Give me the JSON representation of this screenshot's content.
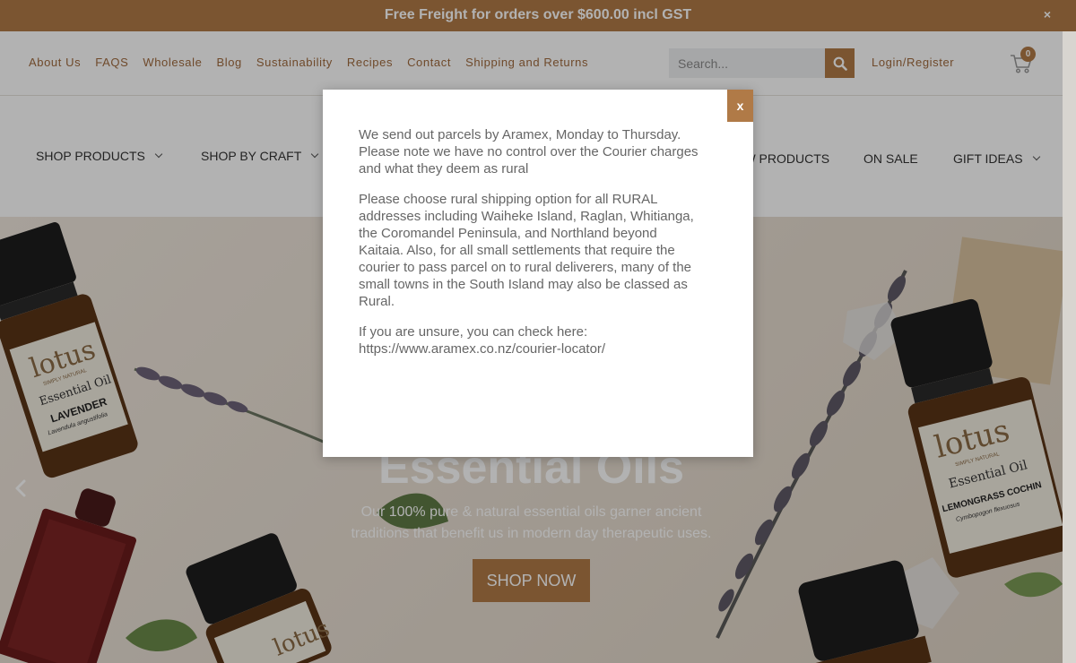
{
  "announcement": {
    "text": "Free Freight for orders over $600.00 incl GST",
    "close_label": "×"
  },
  "utility_nav": [
    "About Us",
    "FAQS",
    "Wholesale",
    "Blog",
    "Sustainability",
    "Recipes",
    "Contact",
    "Shipping and Returns"
  ],
  "search": {
    "placeholder": "Search...",
    "icon": "search-icon"
  },
  "account": {
    "label": "Login/Register"
  },
  "cart": {
    "count": "0",
    "icon": "cart-icon"
  },
  "main_nav": {
    "shop_products": "SHOP PRODUCTS",
    "shop_by_craft": "SHOP BY CRAFT",
    "new_products": "NEW PRODUCTS",
    "on_sale": "ON SALE",
    "gift_ideas": "GIFT IDEAS"
  },
  "hero": {
    "title": "Essential Oils",
    "subtitle_line1": "Our 100% pure & natural essential oils garner ancient",
    "subtitle_line2": "traditions that benefit us in modern day therapeutic uses.",
    "cta": "SHOP NOW"
  },
  "modal": {
    "close_label": "x",
    "p1_l1": "We send out parcels by Aramex, Monday to Thursday.",
    "p1_l2": "Please note we have no control over the Courier charges",
    "p1_l3": "and what they deem as rural",
    "p2_l1": "Please choose rural shipping option for all RURAL",
    "p2_l2": "addresses including Waiheke Island, Raglan, Whitianga,",
    "p2_l3": "the Coromandel Peninsula, and Northland beyond",
    "p2_l4": "Kaitaia.  Also, for all small settlements that require the",
    "p2_l5": "courier to pass parcel on to rural deliverers, many of the",
    "p2_l6": "small towns in the South Island may also be classed as",
    "p2_l7": "Rural.",
    "p3_l1": "If you are unsure, you can check here:",
    "p3_l2": "https://www.aramex.co.nz/courier-locator/"
  },
  "product_labels": {
    "brand": "lotus",
    "brand_tag": "SIMPLY NATURAL",
    "product_type": "Essential Oil",
    "oil_left": "LAVENDER",
    "oil_left_latin": "Lavendula angustifolia",
    "oil_right": "LEMONGRASS COCHIN",
    "oil_right_latin": "Cymbopogon flexuosus"
  },
  "colors": {
    "brand": "#b07a47",
    "text_link": "#a06a3e"
  }
}
